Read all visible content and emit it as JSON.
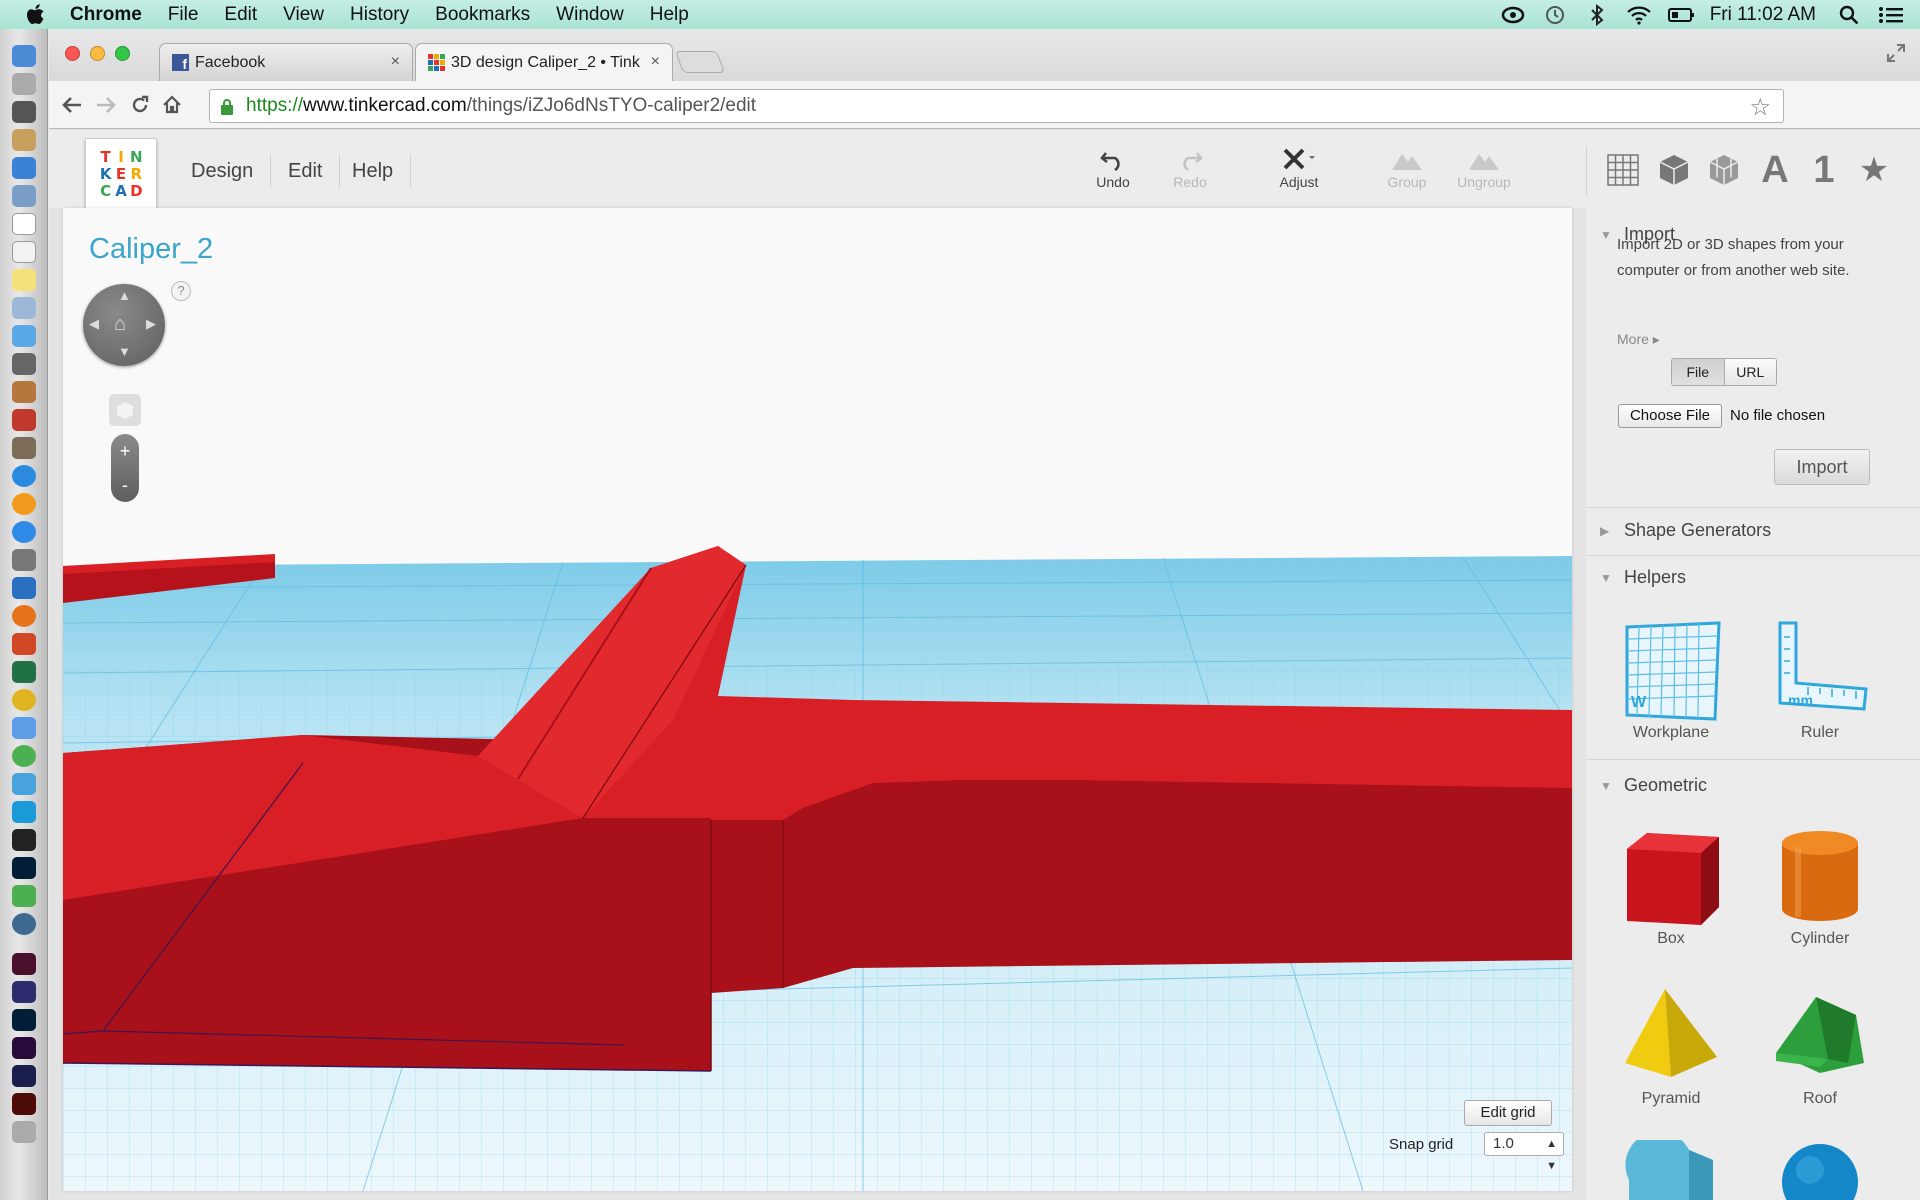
{
  "menubar": {
    "app": "Chrome",
    "items": [
      "File",
      "Edit",
      "View",
      "History",
      "Bookmarks",
      "Window",
      "Help"
    ],
    "clock": "Fri 11:02 AM"
  },
  "browser": {
    "tabs": [
      {
        "title": "Facebook",
        "close": "×"
      },
      {
        "title": "3D design Caliper_2 • Tink",
        "close": "×"
      }
    ],
    "url": {
      "scheme": "https://",
      "host": "www.tinkercad.com",
      "path": "/things/iZJo6dNsTYO-caliper2/edit"
    }
  },
  "app": {
    "logo_letters": [
      "T",
      "I",
      "N",
      "K",
      "E",
      "R",
      "C",
      "A",
      "D"
    ],
    "menu": [
      "Design",
      "Edit",
      "Help"
    ],
    "tools": [
      {
        "label": "Undo",
        "enabled": true
      },
      {
        "label": "Redo",
        "enabled": false
      },
      {
        "label": "Adjust",
        "enabled": true
      },
      {
        "label": "Group",
        "enabled": false
      },
      {
        "label": "Ungroup",
        "enabled": false
      }
    ],
    "view_icons": [
      "grid-view-icon",
      "box-view-icon",
      "wireframe-view-icon",
      "text-shapes-icon",
      "number-shapes-icon",
      "favorites-icon"
    ],
    "view_letter_a": "A",
    "view_number_1": "1",
    "view_star": "★"
  },
  "workspace": {
    "design_title": "Caliper_2",
    "help": "?",
    "zoom_in": "+",
    "zoom_out": "-",
    "edit_grid": "Edit grid",
    "snap_label": "Snap grid",
    "snap_value": "1.0",
    "shape_color": "#d91f26"
  },
  "sidebar": {
    "import": {
      "title": "Import",
      "text": "Import 2D or 3D shapes from your computer or from another web site.",
      "more": "More",
      "tabs": [
        "File",
        "URL"
      ],
      "choose": "Choose File",
      "nofile": "No file chosen",
      "button": "Import"
    },
    "shape_generators": "Shape Generators",
    "helpers": {
      "title": "Helpers",
      "items": [
        "Workplane",
        "Ruler"
      ]
    },
    "geometric": {
      "title": "Geometric",
      "items": [
        "Box",
        "Cylinder",
        "Pyramid",
        "Roof"
      ]
    }
  }
}
